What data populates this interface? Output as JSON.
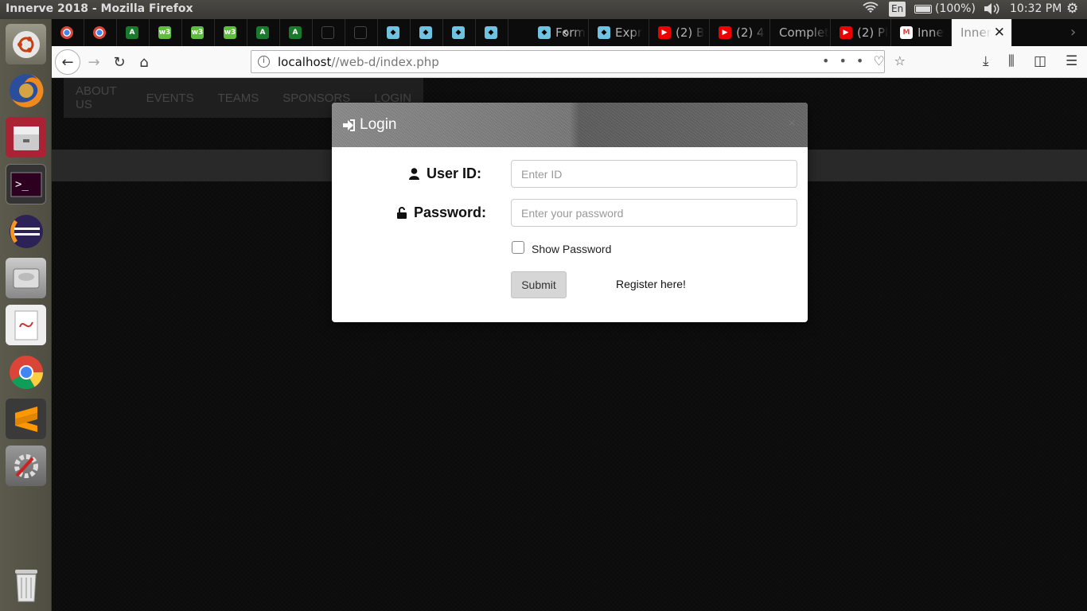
{
  "system": {
    "window_title": "Innerve 2018 - Mozilla Firefox",
    "lang": "En",
    "battery": "(100%)",
    "clock": "10:32 PM"
  },
  "launcher": {
    "items": [
      "ubuntu-dash",
      "firefox",
      "files",
      "terminal",
      "eclipse",
      "disks",
      "document-viewer",
      "chrome",
      "sublime-text",
      "system-tools",
      "trash"
    ]
  },
  "browser": {
    "tabs": [
      {
        "label": "",
        "icon": "chrome"
      },
      {
        "label": "",
        "icon": "chrome"
      },
      {
        "label": "",
        "icon": "android-studio"
      },
      {
        "label": "",
        "icon": "w3schools"
      },
      {
        "label": "",
        "icon": "w3schools"
      },
      {
        "label": "",
        "icon": "w3schools"
      },
      {
        "label": "",
        "icon": "android-studio"
      },
      {
        "label": "",
        "icon": "android-studio"
      },
      {
        "label": "",
        "icon": "codepen"
      },
      {
        "label": "",
        "icon": "codepen"
      },
      {
        "label": "",
        "icon": "formspree"
      },
      {
        "label": "",
        "icon": "formspree"
      },
      {
        "label": "",
        "icon": "formspree"
      },
      {
        "label": "",
        "icon": "formspree"
      },
      {
        "label": "Form",
        "icon": "formspree"
      },
      {
        "label": "Expr",
        "icon": "formspree"
      },
      {
        "label": "(2) B",
        "icon": "youtube"
      },
      {
        "label": "(2) 4",
        "icon": "youtube"
      },
      {
        "label": "Complet",
        "icon": "none"
      },
      {
        "label": "(2) Pl",
        "icon": "youtube"
      },
      {
        "label": "Inne",
        "icon": "gmail"
      },
      {
        "label": "Inner",
        "icon": "none",
        "active": true
      }
    ],
    "url_host": "localhost",
    "url_path": "//web-d/index.php"
  },
  "site": {
    "menu": [
      "ABOUT US",
      "EVENTS",
      "TEAMS",
      "SPONSORS",
      "LOGIN"
    ]
  },
  "modal": {
    "title": "Login",
    "close": "×",
    "user_label": "User ID:",
    "user_placeholder": "Enter ID",
    "password_label": "Password:",
    "password_placeholder": "Enter your password",
    "show_password": "Show Password",
    "submit": "Submit",
    "register": "Register here!"
  },
  "colors": {
    "tabbar_bg": "#0c0c0d",
    "navbar_bg": "#f9f9fa",
    "page_bg": "#191919",
    "submit_bg": "#d6d6d6"
  }
}
